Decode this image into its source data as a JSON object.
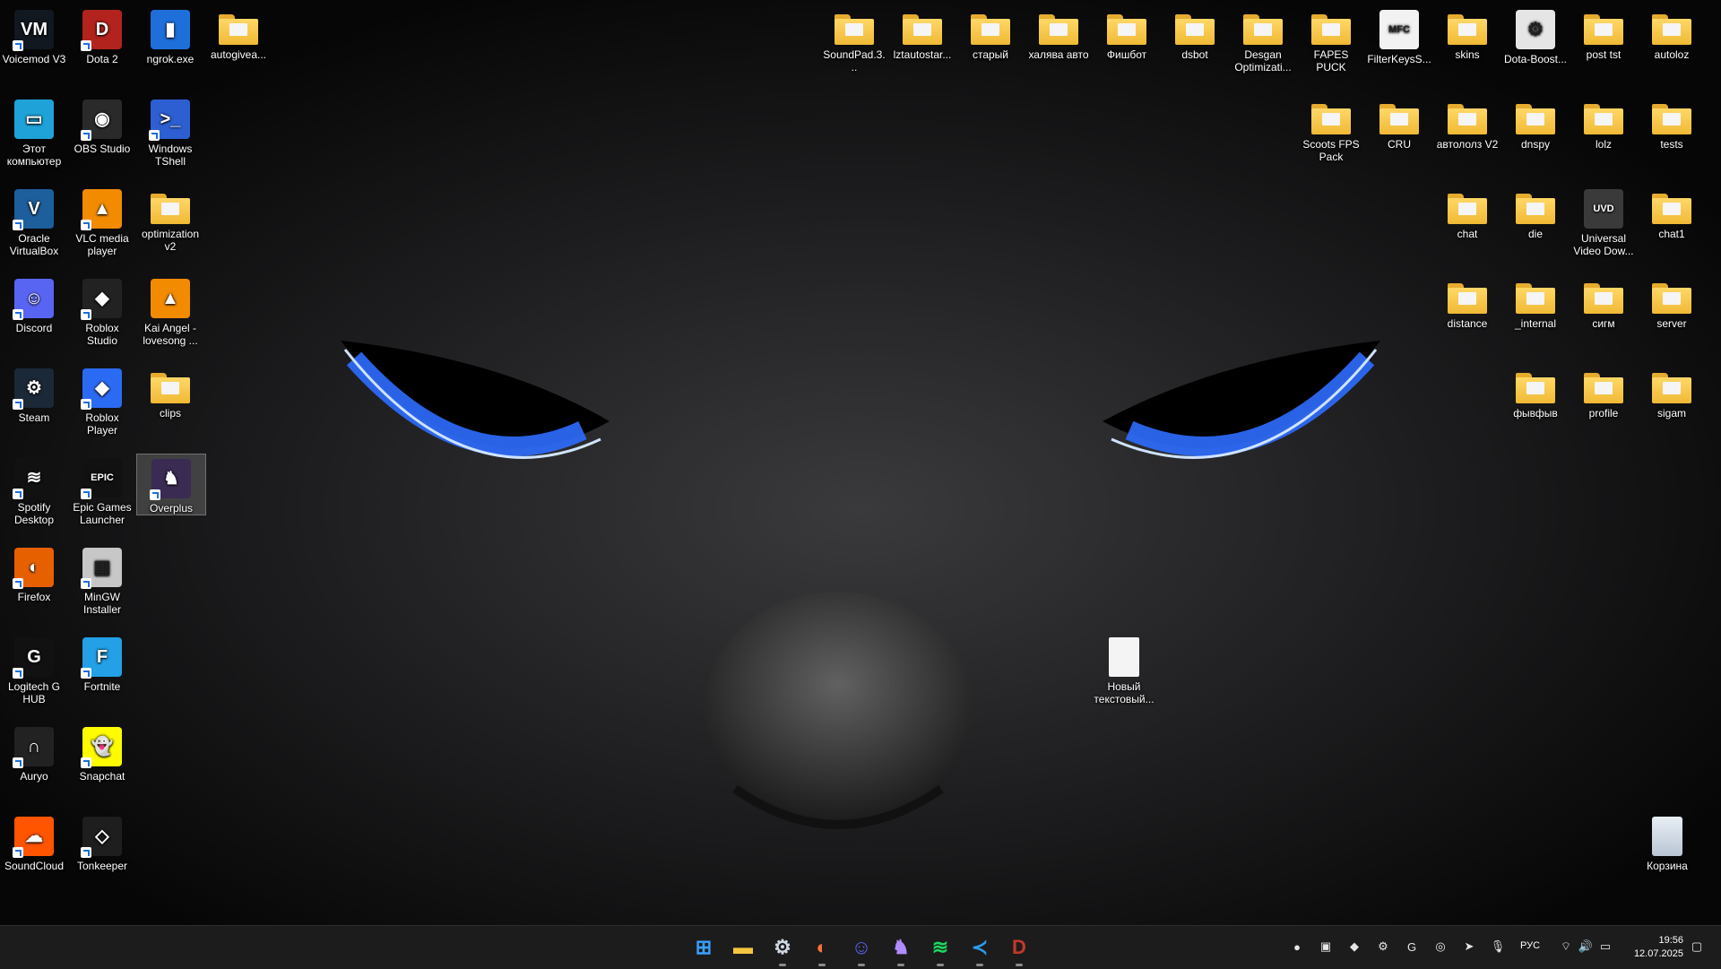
{
  "desktop": {
    "left_icons": [
      {
        "label": "Voicemod V3",
        "kind": "app",
        "color": "#111820",
        "glyph": "VM",
        "shortcut": true
      },
      {
        "label": "Dota 2",
        "kind": "app",
        "color": "#b3231d",
        "glyph": "D",
        "shortcut": true
      },
      {
        "label": "ngrok.exe",
        "kind": "app",
        "color": "#1e6fd9",
        "glyph": "▮",
        "shortcut": false
      },
      {
        "label": "autogivea...",
        "kind": "folder"
      },
      {
        "label": "Этот компьютер",
        "kind": "app",
        "color": "#1fa2d8",
        "glyph": "▭",
        "shortcut": false
      },
      {
        "label": "OBS Studio",
        "kind": "app",
        "color": "#2a2a2a",
        "glyph": "◉",
        "shortcut": true
      },
      {
        "label": "Windows TShell",
        "kind": "app",
        "color": "#2d5fd3",
        "glyph": ">_",
        "shortcut": true
      },
      {
        "label": "Oracle VirtualBox",
        "kind": "app",
        "color": "#1d5e9c",
        "glyph": "V",
        "shortcut": true
      },
      {
        "label": "VLC media player",
        "kind": "app",
        "color": "#f28b00",
        "glyph": "▲",
        "shortcut": true
      },
      {
        "label": "optimization v2",
        "kind": "folder"
      },
      {
        "label": "Discord",
        "kind": "app",
        "color": "#5865f2",
        "glyph": "☺",
        "shortcut": true
      },
      {
        "label": "Roblox Studio",
        "kind": "app",
        "color": "#222",
        "glyph": "◆",
        "shortcut": true
      },
      {
        "label": "Kai Angel - lovesong ...",
        "kind": "app",
        "color": "#f28b00",
        "glyph": "▲",
        "shortcut": false
      },
      {
        "label": "Steam",
        "kind": "app",
        "color": "#1b2838",
        "glyph": "⚙",
        "shortcut": true
      },
      {
        "label": "Roblox Player",
        "kind": "app",
        "color": "#2b6bf3",
        "glyph": "◆",
        "shortcut": true
      },
      {
        "label": "clips",
        "kind": "folder"
      },
      {
        "label": "Spotify Desktop",
        "kind": "app",
        "color": "#111",
        "glyph": "≋",
        "shortcut": true
      },
      {
        "label": "Epic Games Launcher",
        "kind": "app",
        "color": "#111",
        "glyph": "EPIC",
        "shortcut": true
      },
      {
        "label": "Overplus",
        "kind": "app",
        "color": "#3a2b52",
        "glyph": "♞",
        "shortcut": true,
        "selected": true
      },
      {
        "label": "Firefox",
        "kind": "app",
        "color": "#e66000",
        "glyph": "◐",
        "shortcut": true
      },
      {
        "label": "MinGW Installer",
        "kind": "app",
        "color": "#c7c7c7",
        "glyph": "▦",
        "shortcut": true
      },
      {
        "label": "Logitech G HUB",
        "kind": "app",
        "color": "#111",
        "glyph": "G",
        "shortcut": true
      },
      {
        "label": "Fortnite",
        "kind": "app",
        "color": "#23a0e6",
        "glyph": "F",
        "shortcut": true
      },
      {
        "label": "Auryo",
        "kind": "app",
        "color": "#222",
        "glyph": "∩",
        "shortcut": true
      },
      {
        "label": "Snapchat",
        "kind": "app",
        "color": "#fffc00",
        "glyph": "👻",
        "shortcut": true
      },
      {
        "label": "SoundCloud",
        "kind": "app",
        "color": "#ff5500",
        "glyph": "☁",
        "shortcut": true
      },
      {
        "label": "Tonkeeper",
        "kind": "app",
        "color": "#1e1e1e",
        "glyph": "◇",
        "shortcut": true
      }
    ],
    "right_icons": [
      {
        "label": "SoundPad.3...",
        "kind": "folder"
      },
      {
        "label": "lztautostar...",
        "kind": "folder"
      },
      {
        "label": "старый",
        "kind": "folder"
      },
      {
        "label": "халява авто",
        "kind": "folder"
      },
      {
        "label": "Фишбот",
        "kind": "folder"
      },
      {
        "label": "dsbot",
        "kind": "folder"
      },
      {
        "label": "Desgan Optimizati...",
        "kind": "folder"
      },
      {
        "label": "FAPES PUCK",
        "kind": "folder"
      },
      {
        "label": "FilterKeysS...",
        "kind": "app",
        "color": "#f2f2f2",
        "glyph": "MFC",
        "shortcut": false
      },
      {
        "label": "skins",
        "kind": "folder"
      },
      {
        "label": "Dota-Boost...",
        "kind": "app",
        "color": "#e5e5e5",
        "glyph": "⚙",
        "shortcut": false
      },
      {
        "label": "post tst",
        "kind": "folder"
      },
      {
        "label": "autoloz",
        "kind": "folder"
      },
      {
        "label": "Scoots FPS Pack",
        "kind": "folder"
      },
      {
        "label": "CRU",
        "kind": "folder"
      },
      {
        "label": "автололз V2",
        "kind": "folder"
      },
      {
        "label": "dnspy",
        "kind": "folder"
      },
      {
        "label": "lolz",
        "kind": "folder"
      },
      {
        "label": "tests",
        "kind": "folder"
      },
      {
        "label": "chat",
        "kind": "folder"
      },
      {
        "label": "die",
        "kind": "folder"
      },
      {
        "label": "Universal Video Dow...",
        "kind": "app",
        "color": "#3a3a3a",
        "glyph": "UVD",
        "shortcut": false
      },
      {
        "label": "chat1",
        "kind": "folder"
      },
      {
        "label": "distance",
        "kind": "folder"
      },
      {
        "label": "_internal",
        "kind": "folder"
      },
      {
        "label": "сигм",
        "kind": "folder"
      },
      {
        "label": "server",
        "kind": "folder"
      },
      {
        "label": "фывфыв",
        "kind": "folder"
      },
      {
        "label": "profile",
        "kind": "folder"
      },
      {
        "label": "sigam",
        "kind": "folder"
      }
    ],
    "new_text_file": {
      "label": "Новый текстовый..."
    },
    "recycle_bin": {
      "label": "Корзина"
    }
  },
  "taskbar": {
    "apps": [
      {
        "name": "start-button",
        "glyph": "⊞",
        "color": "#3aa0ff"
      },
      {
        "name": "file-explorer",
        "glyph": "▬",
        "color": "#f4c542"
      },
      {
        "name": "steam",
        "glyph": "⚙",
        "color": "#cfd8e3"
      },
      {
        "name": "firefox",
        "glyph": "◐",
        "color": "#ff7139"
      },
      {
        "name": "discord",
        "glyph": "☺",
        "color": "#5865f2"
      },
      {
        "name": "overplus",
        "glyph": "♞",
        "color": "#b18cff"
      },
      {
        "name": "spotify",
        "glyph": "≋",
        "color": "#1ed760"
      },
      {
        "name": "vscode",
        "glyph": "≺",
        "color": "#2f9cf0"
      },
      {
        "name": "dota",
        "glyph": "D",
        "color": "#c0392b"
      }
    ],
    "tray": [
      "●",
      "▣",
      "◆",
      "⚙",
      "G",
      "◎",
      "➤",
      "🎙"
    ],
    "language": "РУС",
    "time": "19:56",
    "date": "12.07.2025"
  }
}
